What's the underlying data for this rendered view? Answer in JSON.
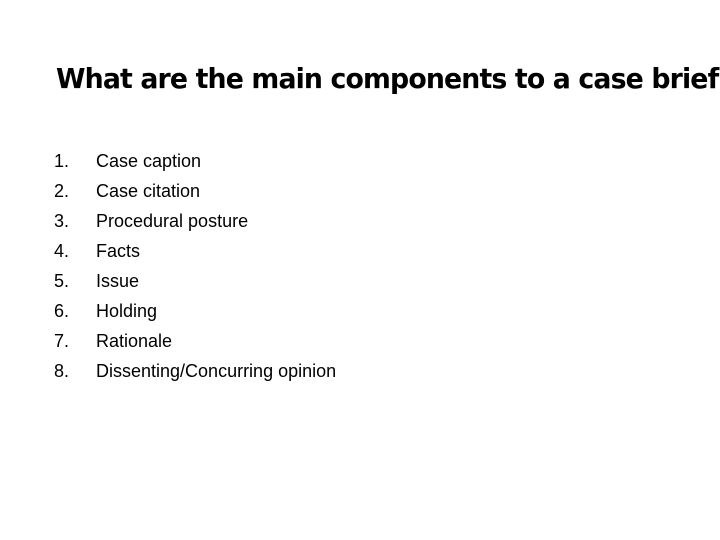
{
  "slide": {
    "title": "What are the main components to a case brief",
    "background_color": "#ffffff",
    "text_color": "#000000",
    "items": [
      {
        "number": "1.",
        "label": "Case caption"
      },
      {
        "number": "2.",
        "label": "Case citation"
      },
      {
        "number": "3.",
        "label": "Procedural posture"
      },
      {
        "number": "4.",
        "label": "Facts"
      },
      {
        "number": "5.",
        "label": "Issue"
      },
      {
        "number": "6.",
        "label": "Holding"
      },
      {
        "number": "7.",
        "label": "Rationale"
      },
      {
        "number": "8.",
        "label": "Dissenting/Concurring opinion"
      }
    ]
  }
}
